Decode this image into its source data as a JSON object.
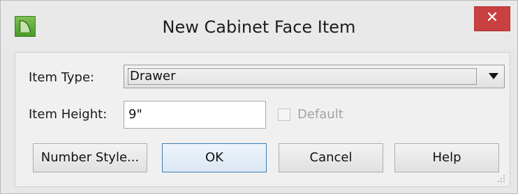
{
  "dialog": {
    "title": "New Cabinet Face Item",
    "close_label": "✕"
  },
  "form": {
    "item_type_label": "Item Type:",
    "item_type_value": "Drawer",
    "item_height_label": "Item Height:",
    "item_height_value": "9\"",
    "default_label": "Default",
    "default_checked": false,
    "default_enabled": false
  },
  "buttons": {
    "number_style": "Number Style...",
    "ok": "OK",
    "cancel": "Cancel",
    "help": "Help"
  },
  "icons": {
    "app": "app-logo-icon",
    "close": "close-icon",
    "dropdown": "chevron-down-icon",
    "grip": "resize-grip-icon"
  },
  "colors": {
    "close_button": "#c94040",
    "default_button_border": "#3c7fb1",
    "app_icon": "#5aa534"
  }
}
